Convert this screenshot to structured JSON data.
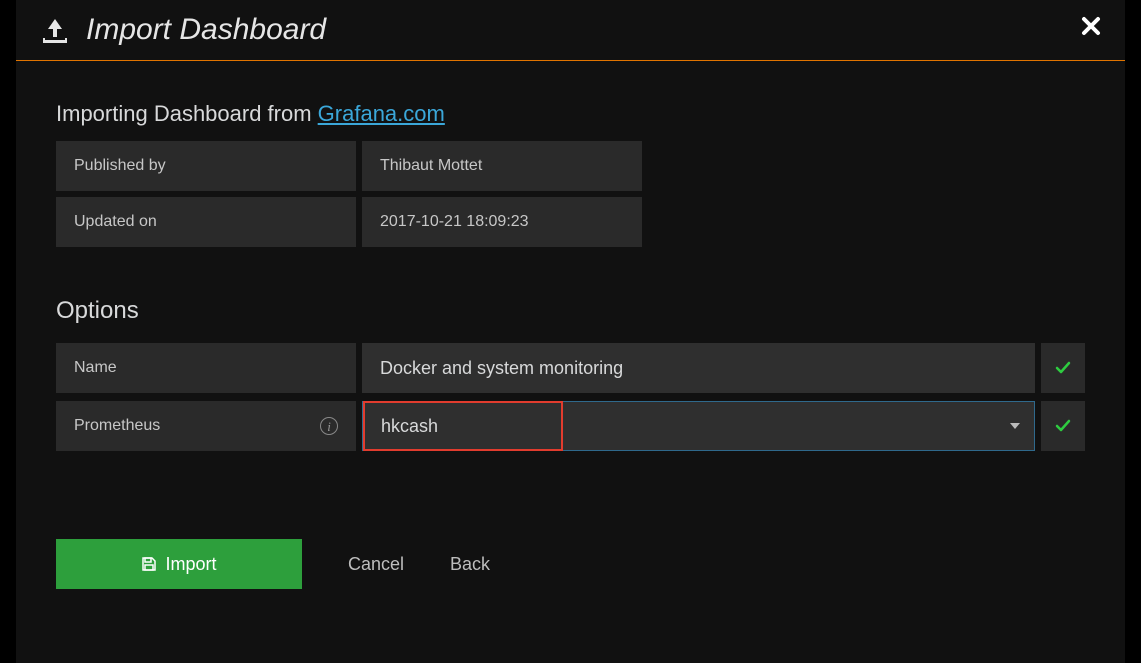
{
  "header": {
    "title": "Import Dashboard"
  },
  "importing": {
    "heading_prefix": "Importing Dashboard from ",
    "source_link_text": "Grafana.com",
    "rows": [
      {
        "label": "Published by",
        "value": "Thibaut Mottet"
      },
      {
        "label": "Updated on",
        "value": "2017-10-21 18:09:23"
      }
    ]
  },
  "options": {
    "heading": "Options",
    "name_label": "Name",
    "name_value": "Docker and system monitoring",
    "prometheus_label": "Prometheus",
    "prometheus_value": "hkcash"
  },
  "actions": {
    "import": "Import",
    "cancel": "Cancel",
    "back": "Back"
  }
}
